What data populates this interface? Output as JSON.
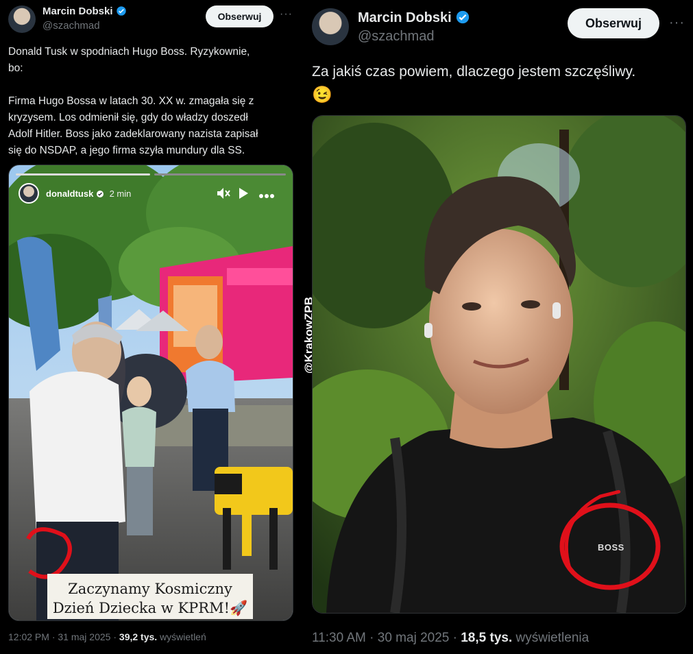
{
  "left_tweet": {
    "author_name": "Marcin Dobski",
    "author_handle": "@szachmad",
    "follow_label": "Obserwuj",
    "more_label": "···",
    "text_line1": "Donald Tusk w spodniach Hugo Boss. Ryzykownie,",
    "text_line2": "bo:",
    "text_line3": "Firma Hugo Bossa w latach 30. XX w. zmagała się z",
    "text_line4": "kryzysem. Los odmienił się, gdy do władzy doszedł",
    "text_line5": "Adolf Hitler. Boss jako zadeklarowany nazista zapisał",
    "text_line6": "się do NSDAP, a jego firma szyła mundury dla SS.",
    "story": {
      "username": "donaldtusk",
      "time": "2 min",
      "caption_line1": "Zaczynamy Kosmiczny",
      "caption_line2": "Dzień Dziecka w KPRM!🚀"
    },
    "time": "12:02 PM",
    "separator": "·",
    "date": "31 maj 2025",
    "views_count": "39,2 tys.",
    "views_label": "wyświetleń"
  },
  "watermark": "@KrakowZPB",
  "right_tweet": {
    "author_name": "Marcin Dobski",
    "author_handle": "@szachmad",
    "follow_label": "Obserwuj",
    "more_label": "···",
    "text": "Za jakiś czas powiem, dlaczego jestem szczęśliwy.",
    "emoji": "😉",
    "shirt_logo": "BOSS",
    "time": "11:30 AM",
    "separator": "·",
    "date": "30 maj 2025",
    "views_count": "18,5 tys.",
    "views_label": "wyświetlenia"
  },
  "colors": {
    "background": "#000000",
    "verified_blue": "#1d9bf0",
    "annotation_red": "#e0101a"
  }
}
